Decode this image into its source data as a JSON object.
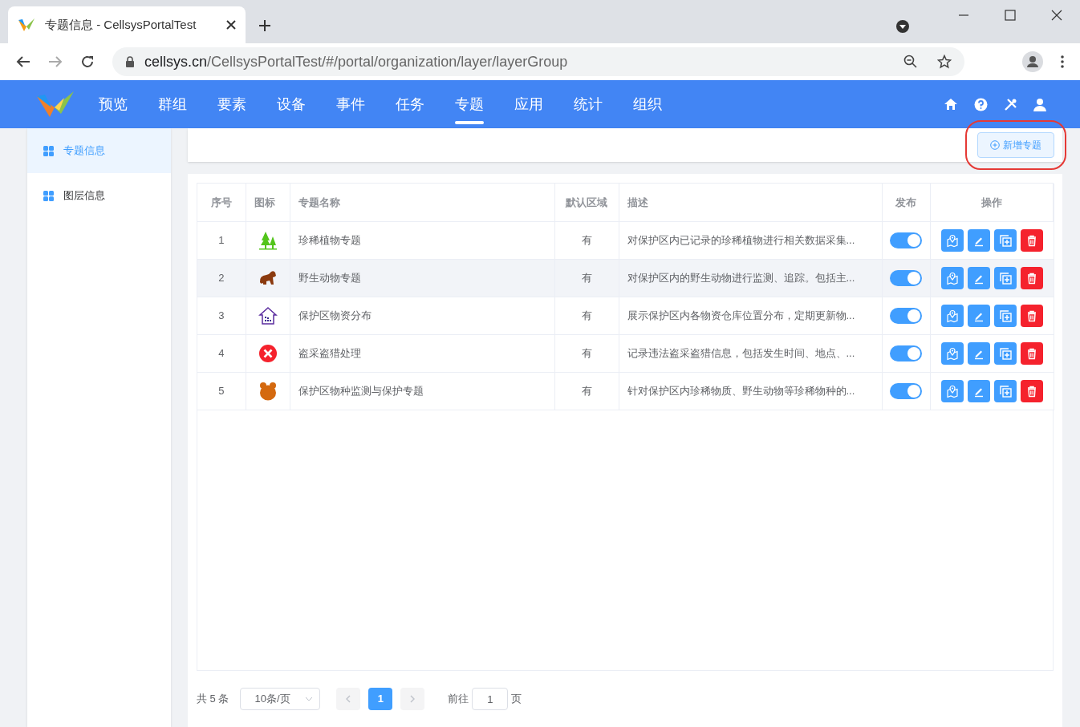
{
  "browser": {
    "tab_title": "专题信息 - CellsysPortalTest",
    "url_host": "cellsys.cn",
    "url_path": "/CellsysPortalTest/#/portal/organization/layer/layerGroup"
  },
  "nav": {
    "items": [
      {
        "label": "预览",
        "selected": false
      },
      {
        "label": "群组",
        "selected": false
      },
      {
        "label": "要素",
        "selected": false
      },
      {
        "label": "设备",
        "selected": false
      },
      {
        "label": "事件",
        "selected": false
      },
      {
        "label": "任务",
        "selected": false
      },
      {
        "label": "专题",
        "selected": true
      },
      {
        "label": "应用",
        "selected": false
      },
      {
        "label": "统计",
        "selected": false
      },
      {
        "label": "组织",
        "selected": false
      }
    ]
  },
  "sidebar": {
    "items": [
      {
        "label": "专题信息",
        "selected": true
      },
      {
        "label": "图层信息",
        "selected": false
      }
    ]
  },
  "toolbar": {
    "add_button": "新增专题"
  },
  "table": {
    "columns": [
      "序号",
      "图标",
      "专题名称",
      "默认区域",
      "描述",
      "发布",
      "操作"
    ],
    "rows": [
      {
        "index": "1",
        "kind": "tree",
        "name": "珍稀植物专题",
        "default_area": "有",
        "description": "对保护区内已记录的珍稀植物进行相关数据采集...",
        "published": true,
        "hovered": false
      },
      {
        "index": "2",
        "kind": "animal",
        "name": "野生动物专题",
        "default_area": "有",
        "description": "对保护区内的野生动物进行监测、追踪。包括主...",
        "published": true,
        "hovered": true
      },
      {
        "index": "3",
        "kind": "house",
        "name": "保护区物资分布",
        "default_area": "有",
        "description": "展示保护区内各物资仓库位置分布，定期更新物...",
        "published": true,
        "hovered": false
      },
      {
        "index": "4",
        "kind": "cross",
        "name": "盗采盗猎处理",
        "default_area": "有",
        "description": "记录违法盗采盗猎信息，包括发生时间、地点、...",
        "published": true,
        "hovered": false
      },
      {
        "index": "5",
        "kind": "bear",
        "name": "保护区物种监测与保护专题",
        "default_area": "有",
        "description": "针对保护区内珍稀物质、野生动物等珍稀物种的...",
        "published": true,
        "hovered": false
      }
    ]
  },
  "pagination": {
    "total": "共 5 条",
    "page_size": "10条/页",
    "pages": [
      {
        "label": "1",
        "selected": true
      }
    ],
    "goto_label": "前往",
    "goto_value": "1",
    "goto_suffix": "页"
  }
}
